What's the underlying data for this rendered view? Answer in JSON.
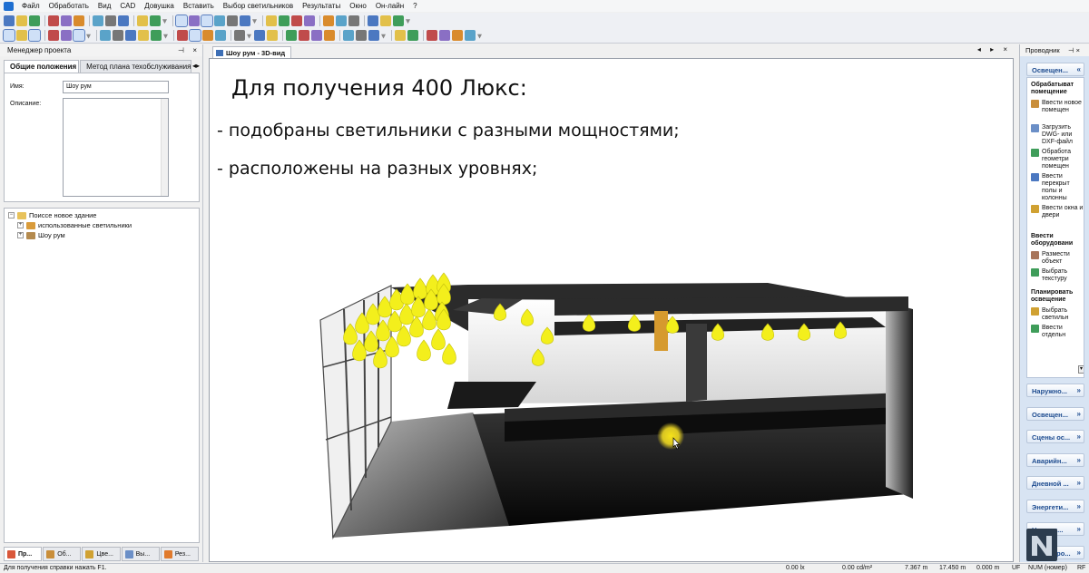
{
  "menu": [
    "Файл",
    "Обработать",
    "Вид",
    "CAD",
    "Довушка",
    "Вставить",
    "Выбор светильников",
    "Результаты",
    "Окно",
    "Он-лайн",
    "?"
  ],
  "toolbar_icons": {
    "row1": [
      "new-file",
      "open-file",
      "save",
      "print",
      "print-preview",
      "pdf",
      "cut",
      "copy",
      "paste",
      "undo",
      "redo",
      "view-3d",
      "view-3d-rotate",
      "floor-plan",
      "pointer",
      "circle-select",
      "sphere",
      "tool-a",
      "tool-b",
      "tool-c",
      "tool-d",
      "tool-e",
      "tool-f",
      "tool-g",
      "layout-a",
      "layout-b",
      "layout-c"
    ],
    "row2": [
      "select",
      "move",
      "rotate",
      "pen",
      "pick",
      "calc",
      "calc-red",
      "light-red",
      "table",
      "check-a",
      "check-b",
      "zoom",
      "hand",
      "orbit",
      "pointer-hand",
      "palette",
      "object-a",
      "object-b",
      "object-c",
      "object-d",
      "object-e",
      "object-f",
      "grid-a",
      "grid-b",
      "grid-c",
      "node",
      "measure",
      "draw-line",
      "draw-curve",
      "rotate-tool",
      "rotate-tool-b"
    ]
  },
  "left_panel": {
    "title": "Менеджер проекта",
    "tabs": [
      "Общие положения",
      "Метод плана техобслуживания"
    ],
    "name_label": "Имя:",
    "name_value": "Шоу рум",
    "description_label": "Описание:",
    "tree": [
      {
        "label": "Поиссе новое здание",
        "level": 0,
        "expander": "−"
      },
      {
        "label": "использованные светильники",
        "level": 1,
        "expander": "+"
      },
      {
        "label": "Шоу рум",
        "level": 1,
        "expander": "+"
      }
    ],
    "bottom_tabs": [
      "Пр...",
      "Об...",
      "Цве...",
      "Вы...",
      "Рез..."
    ]
  },
  "document": {
    "tab_label": "Шоу рум - 3D-вид",
    "close_glyph": "×",
    "controls": "◂ ▸ ×",
    "heading": "Для получения 400 Люкс:",
    "bullets": [
      "- подобраны светильники с разными мощностями;",
      "- расположены на разных уровнях;"
    ]
  },
  "right_panel": {
    "title": "Проводник",
    "pin_glyph": "⊣ ×",
    "open_section": "Освещен...",
    "groups": [
      {
        "title": "Обрабатыват помещение",
        "items": [
          "Ввести новое помещен",
          "Загрузить DWG- или DXF-файл",
          "Обработа геометри помещен",
          "Ввести перекрыт полы и колонны",
          "Ввести окна и двери"
        ]
      },
      {
        "title": "Ввести оборудовани",
        "items": [
          "Размести объект",
          "Выбрать текстуру"
        ]
      },
      {
        "title": "Планировать освещение",
        "items": [
          "Выбрать светильн",
          "Ввести отдельн"
        ]
      }
    ],
    "sections": [
      "Наружно...",
      "Освещен...",
      "Сцены ос...",
      "Аварийн...",
      "Дневной ...",
      "Энергети...",
      "Наружн...",
      "Адаптиро..."
    ],
    "chevron": "»"
  },
  "status_bar": {
    "hint": "Для получения справки нажать F1.",
    "illuminance": "0.00 lx",
    "luminance": "0.00 cd/m²",
    "x": "7.367 m",
    "y": "17.450 m",
    "z": "0.000 m",
    "mode": "NUM (номер)",
    "uf": "UF",
    "rf": "RF"
  },
  "colors": {
    "accent": "#1d4b8f",
    "luminaire": "#f3ef1c",
    "panel_blue": "#d8e4f3"
  }
}
